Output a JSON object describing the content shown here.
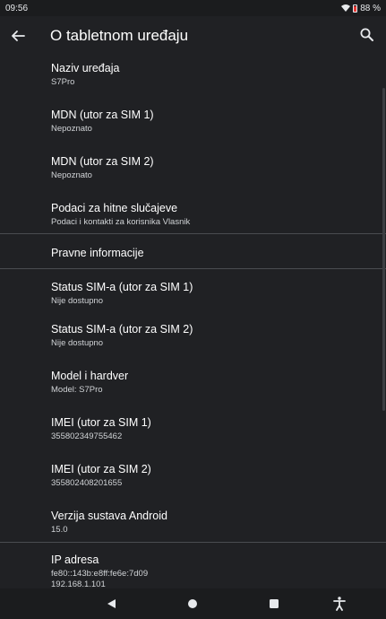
{
  "status_bar": {
    "time": "09:56",
    "battery_percent": "88 %",
    "battery_level": 0.88
  },
  "header": {
    "title": "O tabletnom uređaju"
  },
  "items": [
    {
      "title": "Naziv uređaja",
      "subtitle": "S7Pro"
    },
    {
      "title": "MDN (utor za SIM 1)",
      "subtitle": "Nepoznato"
    },
    {
      "title": "MDN (utor za SIM 2)",
      "subtitle": "Nepoznato"
    },
    {
      "title": "Podaci za hitne slučajeve",
      "subtitle": "Podaci i kontakti za korisnika Vlasnik"
    },
    {
      "title": "Pravne informacije"
    },
    {
      "title": "Status SIM-a (utor za SIM 1)",
      "subtitle": "Nije dostupno"
    },
    {
      "title": "Status SIM-a (utor za SIM 2)",
      "subtitle": "Nije dostupno"
    },
    {
      "title": "Model i hardver",
      "subtitle": "Model: S7Pro"
    },
    {
      "title": "IMEI (utor za SIM 1)",
      "subtitle": "355802349755462"
    },
    {
      "title": "IMEI (utor za SIM 2)",
      "subtitle": "355802408201655"
    },
    {
      "title": "Verzija sustava Android",
      "subtitle": "15.0"
    },
    {
      "title": "IP adresa",
      "subtitle": "fe80::143b:e8ff:fe6e:7d09",
      "subtitle2": "192.168.1.101"
    }
  ],
  "colors": {
    "background": "#202124",
    "text": "#ffffff",
    "secondary": "#d0d3d6",
    "divider": "#4a4c50",
    "battery": "#e53935"
  },
  "icons": {
    "back": "arrow-back-icon",
    "search": "search-icon",
    "nav_back": "triangle-back-icon",
    "nav_home": "circle-home-icon",
    "nav_recents": "square-recents-icon",
    "nav_accessibility": "accessibility-icon"
  }
}
